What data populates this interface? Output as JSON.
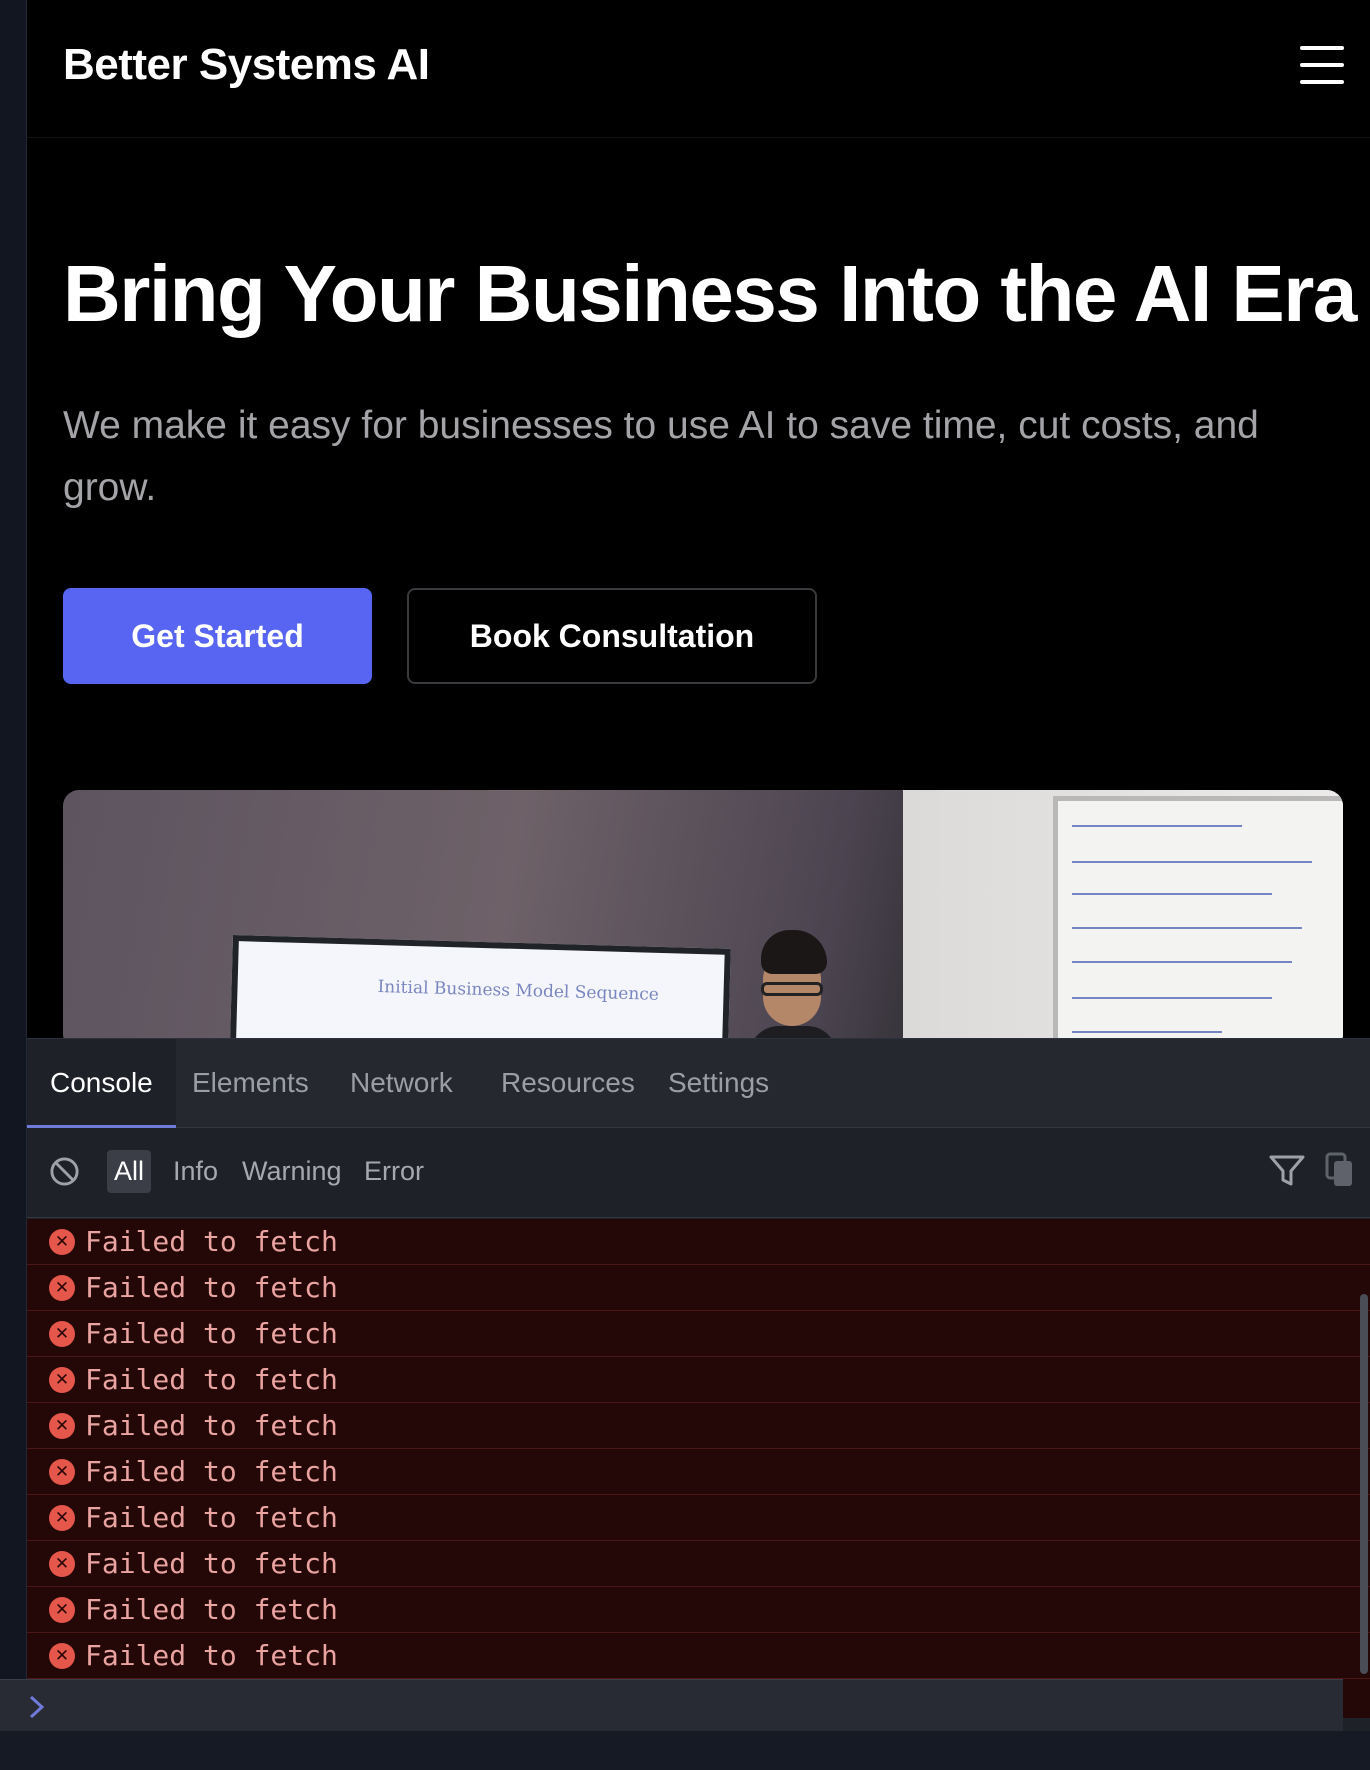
{
  "site": {
    "brand": "Better Systems AI",
    "hero_title": "Bring Your Business Into the AI Era",
    "hero_subtitle": "We make it easy for businesses to use AI to save time, cut costs, and grow.",
    "primary_cta": "Get Started",
    "secondary_cta": "Book Consultation",
    "hero_image_screen_text": "Initial Business Model Sequence",
    "colors": {
      "background": "#000000",
      "primary_button": "#5865f2",
      "subtitle": "#a4a4a8"
    }
  },
  "devtools": {
    "tabs": [
      {
        "label": "Console",
        "active": true
      },
      {
        "label": "Elements",
        "active": false
      },
      {
        "label": "Network",
        "active": false
      },
      {
        "label": "Resources",
        "active": false
      },
      {
        "label": "Settings",
        "active": false
      }
    ],
    "filters": [
      {
        "label": "All",
        "active": true
      },
      {
        "label": "Info",
        "active": false
      },
      {
        "label": "Warning",
        "active": false
      },
      {
        "label": "Error",
        "active": false
      }
    ],
    "icons": [
      "clear-console-icon",
      "filter-funnel-icon",
      "copy-icon",
      "error-icon",
      "prompt-chevron-icon"
    ],
    "log_entries": [
      {
        "level": "error",
        "message": "Failed to fetch"
      },
      {
        "level": "error",
        "message": "Failed to fetch"
      },
      {
        "level": "error",
        "message": "Failed to fetch"
      },
      {
        "level": "error",
        "message": "Failed to fetch"
      },
      {
        "level": "error",
        "message": "Failed to fetch"
      },
      {
        "level": "error",
        "message": "Failed to fetch"
      },
      {
        "level": "error",
        "message": "Failed to fetch"
      },
      {
        "level": "error",
        "message": "Failed to fetch"
      },
      {
        "level": "error",
        "message": "Failed to fetch"
      },
      {
        "level": "error",
        "message": "Failed to fetch"
      }
    ],
    "prompt_value": "",
    "colors": {
      "error_bg": "#240707",
      "error_text": "#e9a3a0",
      "error_icon": "#e5574b",
      "active_tab_underline": "#6f7ad9"
    }
  }
}
